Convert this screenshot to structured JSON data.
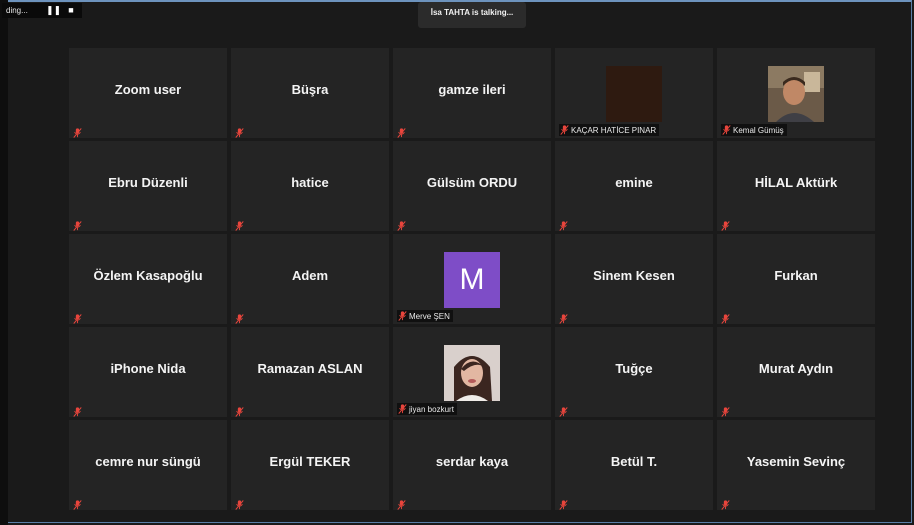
{
  "recording": {
    "text": "ding...",
    "pause_icon": "pause-icon",
    "stop_icon": "stop-icon"
  },
  "talking_banner": "İsa TAHTA is talking...",
  "colors": {
    "tile_bg": "#242424",
    "page_bg": "#1a1a1a",
    "mute": "#e8453c",
    "avatar_bg": "#7e4dc7"
  },
  "participants": [
    {
      "name": "Zoom user",
      "show": "name"
    },
    {
      "name": "Büşra",
      "show": "name"
    },
    {
      "name": "gamze ileri",
      "show": "name"
    },
    {
      "name": "KAÇAR HATİCE PINAR",
      "show": "video-dark"
    },
    {
      "name": "Kemal Gümüş",
      "show": "photo-man"
    },
    {
      "name": "Ebru Düzenli",
      "show": "name"
    },
    {
      "name": "hatice",
      "show": "name"
    },
    {
      "name": "Gülsüm ORDU",
      "show": "name"
    },
    {
      "name": "emine",
      "show": "name"
    },
    {
      "name": "HİLAL Aktürk",
      "show": "name"
    },
    {
      "name": "Özlem Kasapoğlu",
      "show": "name"
    },
    {
      "name": "Adem",
      "show": "name"
    },
    {
      "name": "Merve ŞEN",
      "show": "avatar",
      "initial": "M"
    },
    {
      "name": "Sinem Kesen",
      "show": "name"
    },
    {
      "name": "Furkan",
      "show": "name"
    },
    {
      "name": "iPhone Nida",
      "show": "name"
    },
    {
      "name": "Ramazan ASLAN",
      "show": "name"
    },
    {
      "name": "jiyan bozkurt",
      "show": "photo-woman"
    },
    {
      "name": "Tuğçe",
      "show": "name"
    },
    {
      "name": "Murat Aydın",
      "show": "name"
    },
    {
      "name": "cemre nur süngü",
      "show": "name"
    },
    {
      "name": "Ergül TEKER",
      "show": "name"
    },
    {
      "name": "serdar kaya",
      "show": "name"
    },
    {
      "name": "Betül T.",
      "show": "name"
    },
    {
      "name": "Yasemin Sevinç",
      "show": "name"
    }
  ]
}
